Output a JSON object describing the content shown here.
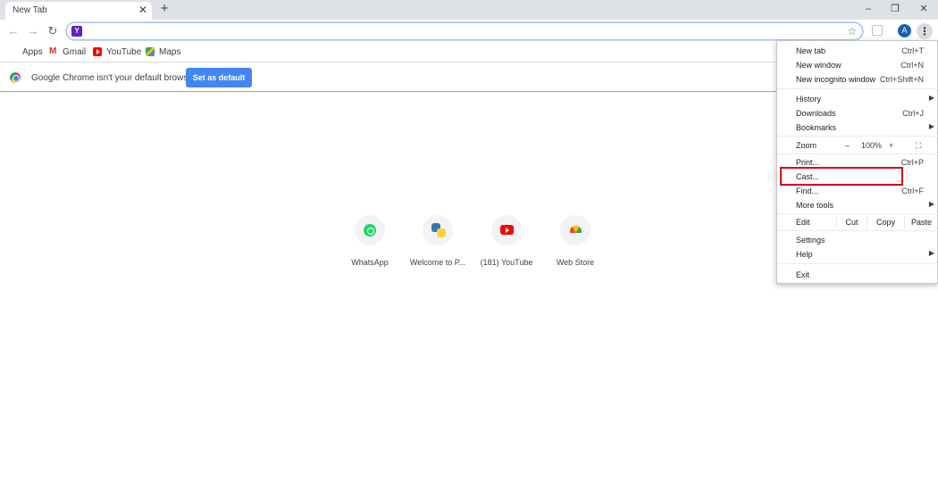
{
  "tab": {
    "title": "New Tab"
  },
  "window_controls": {
    "minimize": "–",
    "restore": "❐",
    "close": "✕"
  },
  "toolbar": {
    "omnibox_value": "",
    "avatar_initial": "A"
  },
  "bookmarks": [
    {
      "label": "Apps"
    },
    {
      "label": "Gmail"
    },
    {
      "label": "YouTube"
    },
    {
      "label": "Maps"
    }
  ],
  "infobar": {
    "message": "Google Chrome isn't your default browser",
    "button": "Set as default"
  },
  "shortcuts": [
    {
      "label": "WhatsApp",
      "icon": "whatsapp-icon"
    },
    {
      "label": "Welcome to P...",
      "icon": "python-icon"
    },
    {
      "label": "(181) YouTube",
      "icon": "youtube-icon"
    },
    {
      "label": "Web Store",
      "icon": "web-store-icon"
    }
  ],
  "menu": {
    "new_tab": {
      "label": "New tab",
      "shortcut": "Ctrl+T"
    },
    "new_window": {
      "label": "New window",
      "shortcut": "Ctrl+N"
    },
    "new_incognito": {
      "label": "New incognito window",
      "shortcut": "Ctrl+Shift+N"
    },
    "history": {
      "label": "History"
    },
    "downloads": {
      "label": "Downloads",
      "shortcut": "Ctrl+J"
    },
    "bookmarks": {
      "label": "Bookmarks"
    },
    "zoom": {
      "label": "Zoom",
      "minus": "–",
      "value": "100%",
      "plus": "+"
    },
    "print": {
      "label": "Print...",
      "shortcut": "Ctrl+P"
    },
    "cast": {
      "label": "Cast..."
    },
    "find": {
      "label": "Find...",
      "shortcut": "Ctrl+F"
    },
    "more_tools": {
      "label": "More tools"
    },
    "edit": {
      "label": "Edit",
      "cut": "Cut",
      "copy": "Copy",
      "paste": "Paste"
    },
    "settings": {
      "label": "Settings"
    },
    "help": {
      "label": "Help"
    },
    "exit": {
      "label": "Exit"
    }
  },
  "colors": {
    "highlight": "#d0021b",
    "accent": "#4285f4"
  }
}
